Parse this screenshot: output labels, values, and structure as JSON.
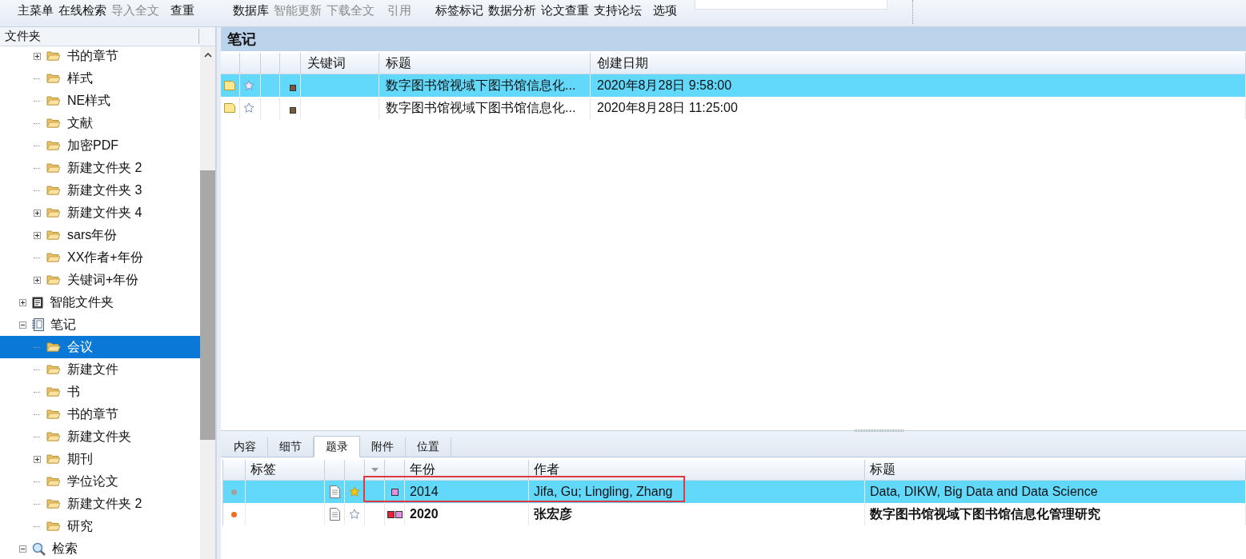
{
  "toolbar": {
    "groups": [
      [
        {
          "label": "主菜单",
          "disabled": false
        },
        {
          "label": "在线检索",
          "disabled": false
        },
        {
          "label": "导入全文",
          "disabled": true
        }
      ],
      [
        {
          "label": "查重",
          "disabled": false
        }
      ],
      [
        {
          "label": "数据库",
          "disabled": false
        },
        {
          "label": "智能更新",
          "disabled": true
        },
        {
          "label": "下载全文",
          "disabled": true
        }
      ],
      [
        {
          "label": "引用",
          "disabled": true
        }
      ],
      [
        {
          "label": "标签标记",
          "disabled": false
        },
        {
          "label": "数据分析",
          "disabled": false
        },
        {
          "label": "论文查重",
          "disabled": false
        },
        {
          "label": "支持论坛",
          "disabled": false
        }
      ],
      [
        {
          "label": "选项",
          "disabled": false
        }
      ]
    ]
  },
  "sidebar": {
    "title": "文件夹",
    "continued_items": [
      {
        "label": "书的章节",
        "kind": "folder",
        "expandable": true,
        "expanded": false,
        "selected": false
      },
      {
        "label": "样式",
        "kind": "folder",
        "expandable": false,
        "selected": false
      },
      {
        "label": "NE样式",
        "kind": "folder",
        "expandable": false,
        "selected": false
      },
      {
        "label": "文献",
        "kind": "folder",
        "expandable": false,
        "selected": false
      },
      {
        "label": "加密PDF",
        "kind": "folder",
        "expandable": false,
        "selected": false
      },
      {
        "label": "新建文件夹 2",
        "kind": "folder",
        "expandable": false,
        "selected": false
      },
      {
        "label": "新建文件夹 3",
        "kind": "folder",
        "expandable": false,
        "selected": false
      },
      {
        "label": "新建文件夹 4",
        "kind": "folder",
        "expandable": true,
        "expanded": false,
        "selected": false
      },
      {
        "label": "sars年份",
        "kind": "folder",
        "expandable": true,
        "expanded": false,
        "selected": false
      },
      {
        "label": "XX作者+年份",
        "kind": "folder",
        "expandable": false,
        "selected": false
      },
      {
        "label": "关键词+年份",
        "kind": "folder",
        "expandable": true,
        "expanded": false,
        "selected": false
      }
    ],
    "items": [
      {
        "label": "智能文件夹",
        "kind": "smart",
        "expandable": true,
        "expanded": false,
        "selected": false
      },
      {
        "label": "笔记",
        "kind": "notes",
        "expandable": true,
        "expanded": true,
        "selected": false,
        "children": [
          {
            "label": "会议",
            "kind": "folder",
            "expandable": false,
            "selected": true
          },
          {
            "label": "新建文件",
            "kind": "folder",
            "expandable": false,
            "selected": false
          },
          {
            "label": "书",
            "kind": "folder",
            "expandable": false,
            "selected": false
          },
          {
            "label": "书的章节",
            "kind": "folder",
            "expandable": false,
            "selected": false
          },
          {
            "label": "新建文件夹",
            "kind": "folder",
            "expandable": false,
            "selected": false
          },
          {
            "label": "期刊",
            "kind": "folder",
            "expandable": true,
            "expanded": false,
            "selected": false
          },
          {
            "label": "学位论文",
            "kind": "folder",
            "expandable": false,
            "selected": false
          },
          {
            "label": "新建文件夹 2",
            "kind": "folder",
            "expandable": false,
            "selected": false
          },
          {
            "label": "研究",
            "kind": "folder",
            "expandable": false,
            "selected": false
          }
        ]
      },
      {
        "label": "检索",
        "kind": "search",
        "expandable": true,
        "expanded": true,
        "selected": false
      }
    ]
  },
  "notes": {
    "title": "笔记",
    "columns": [
      "关键词",
      "标题",
      "创建日期"
    ],
    "rows": [
      {
        "selected": true,
        "starred": false,
        "label": {
          "color": "#7a5a3c"
        },
        "title": "数字图书馆视域下图书馆信息化...",
        "created": "2020年8月28日 9:58:00"
      },
      {
        "selected": false,
        "starred": false,
        "label": {
          "color": "#7a5a3c"
        },
        "title": "数字图书馆视域下图书馆信息化...",
        "created": "2020年8月28日 11:25:00"
      }
    ]
  },
  "reference": {
    "tabs": [
      {
        "label": "内容",
        "selected": false
      },
      {
        "label": "细节",
        "selected": false
      },
      {
        "label": "题录",
        "selected": true
      },
      {
        "label": "附件",
        "selected": false
      },
      {
        "label": "位置",
        "selected": false
      }
    ],
    "columns": [
      "标签",
      "年份",
      "作者",
      "标题"
    ],
    "rows": [
      {
        "selected": true,
        "unread": false,
        "status_dot": {
          "color": "#a0a0a0"
        },
        "starred": true,
        "tags": [
          {
            "color": "#e48ee4"
          }
        ],
        "year": "2014",
        "authors": "Jifa, Gu; Lingling, Zhang",
        "title": "Data, DIKW, Big Data and Data Science"
      },
      {
        "selected": false,
        "unread": true,
        "status_dot": {
          "color": "#f07020"
        },
        "starred": false,
        "tags": [
          {
            "color": "#e8203a"
          },
          {
            "color": "#e48ee4"
          }
        ],
        "year": "2020",
        "authors": "张宏彦",
        "title": "数字图书馆视域下图书馆信息化管理研究"
      }
    ],
    "annotations": [
      {
        "kind": "rectangle",
        "color": "#e0393e"
      }
    ]
  }
}
